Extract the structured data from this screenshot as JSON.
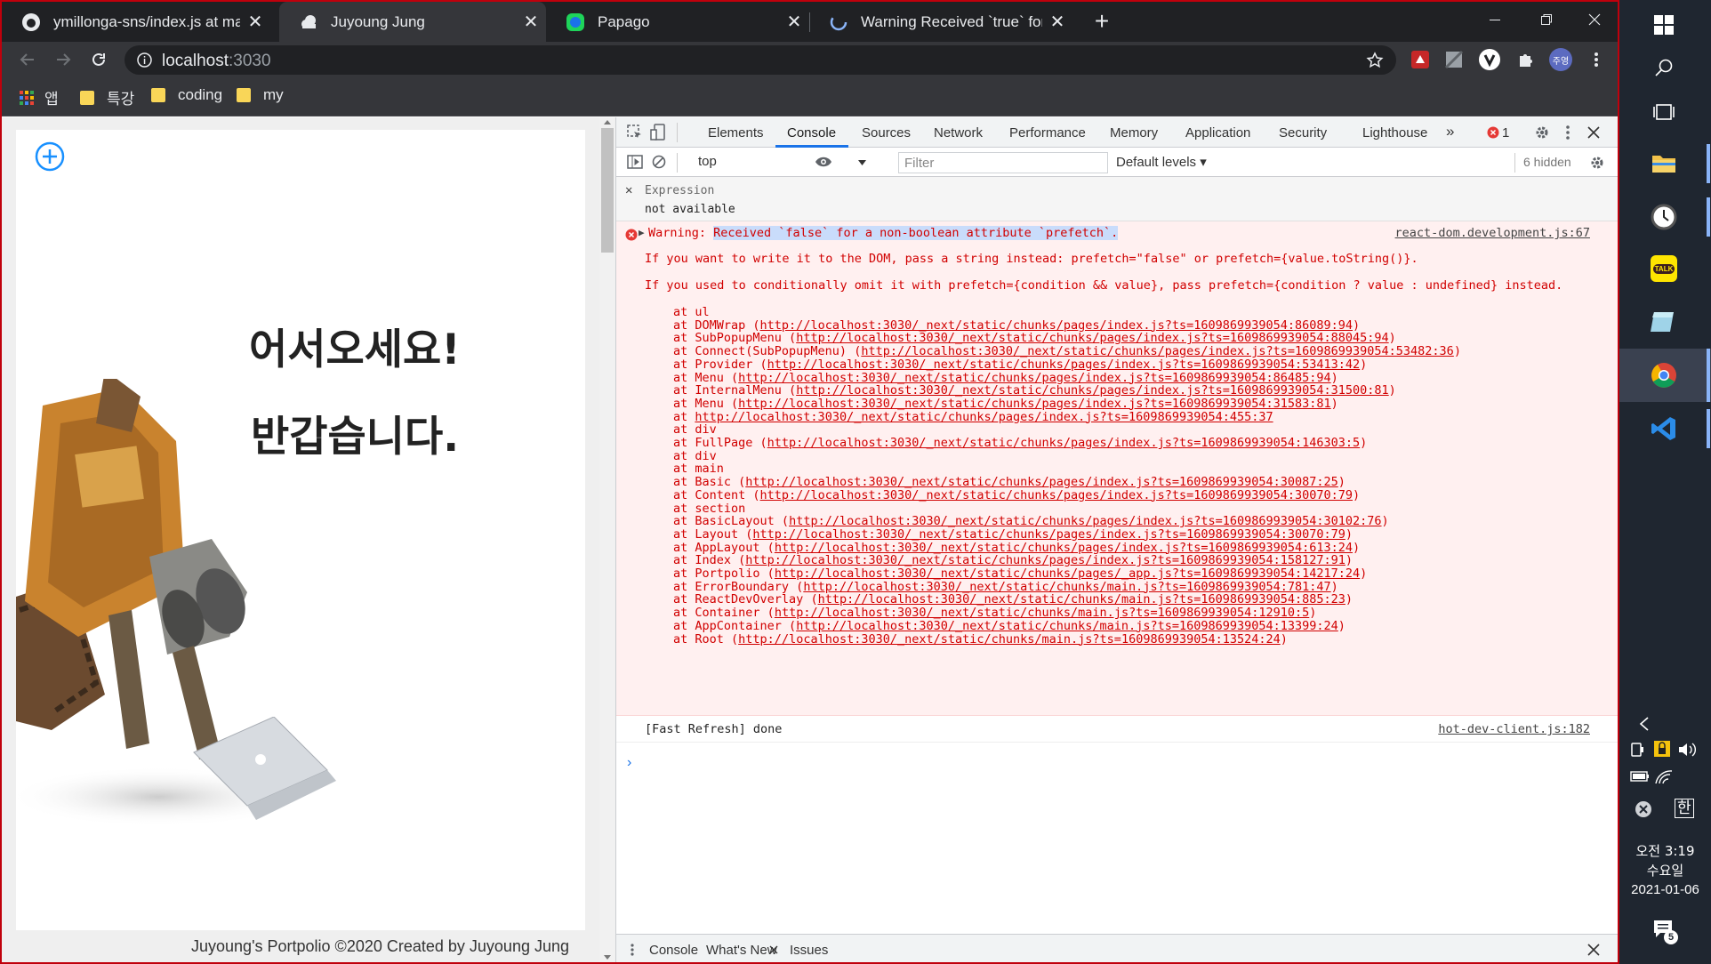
{
  "browser": {
    "tabs": [
      {
        "title": "ymillonga-sns/index.js at main ·",
        "icon": "github-icon"
      },
      {
        "title": "Juyoung Jung",
        "icon": "cloud-icon"
      },
      {
        "title": "Papago",
        "icon": "papago-icon"
      },
      {
        "title": "Warning Received `true` for non",
        "icon": "spinner-icon"
      }
    ],
    "url_host": "localhost",
    "url_port": ":3030",
    "bookmarks": [
      {
        "label": "앱"
      },
      {
        "label": "특강"
      },
      {
        "label": "coding"
      },
      {
        "label": "my"
      }
    ],
    "profile_badge": "주영"
  },
  "page": {
    "welcome_line1": "어서오세요!",
    "welcome_line2": "반갑습니다.",
    "footer": "Juyoung's Portpolio ©2020 Created by Juyoung Jung"
  },
  "devtools": {
    "tabs": [
      "Elements",
      "Console",
      "Sources",
      "Network",
      "Performance",
      "Memory",
      "Application",
      "Security",
      "Lighthouse"
    ],
    "error_count": "1",
    "context": "top",
    "filter_placeholder": "Filter",
    "levels": "Default levels",
    "hidden": "6 hidden",
    "expression_label": "Expression",
    "expression_value": "not available",
    "warning_prefix": "Warning: ",
    "warning_highlight": "Received `false` for a non-boolean attribute `prefetch`.",
    "warning_source": "react-dom.development.js:67",
    "warning_line2": "If you want to write it to the DOM, pass a string instead: prefetch=\"false\" or prefetch={value.toString()}.",
    "warning_line3": "If you used to conditionally omit it with prefetch={condition && value}, pass prefetch={condition ? value : undefined} instead.",
    "stack": [
      {
        "name": "ul",
        "url": ""
      },
      {
        "name": "DOMWrap",
        "url": "http://localhost:3030/_next/static/chunks/pages/index.js?ts=1609869939054:86089:94"
      },
      {
        "name": "SubPopupMenu",
        "url": "http://localhost:3030/_next/static/chunks/pages/index.js?ts=1609869939054:88045:94"
      },
      {
        "name": "Connect(SubPopupMenu)",
        "url": "http://localhost:3030/_next/static/chunks/pages/index.js?ts=1609869939054:53482:36"
      },
      {
        "name": "Provider",
        "url": "http://localhost:3030/_next/static/chunks/pages/index.js?ts=1609869939054:53413:42"
      },
      {
        "name": "Menu",
        "url": "http://localhost:3030/_next/static/chunks/pages/index.js?ts=1609869939054:86485:94"
      },
      {
        "name": "InternalMenu",
        "url": "http://localhost:3030/_next/static/chunks/pages/index.js?ts=1609869939054:31500:81"
      },
      {
        "name": "Menu",
        "url": "http://localhost:3030/_next/static/chunks/pages/index.js?ts=1609869939054:31583:81"
      },
      {
        "name": "",
        "url": "http://localhost:3030/_next/static/chunks/pages/index.js?ts=1609869939054:455:37"
      },
      {
        "name": "div",
        "url": ""
      },
      {
        "name": "FullPage",
        "url": "http://localhost:3030/_next/static/chunks/pages/index.js?ts=1609869939054:146303:5"
      },
      {
        "name": "div",
        "url": ""
      },
      {
        "name": "main",
        "url": ""
      },
      {
        "name": "Basic",
        "url": "http://localhost:3030/_next/static/chunks/pages/index.js?ts=1609869939054:30087:25"
      },
      {
        "name": "Content",
        "url": "http://localhost:3030/_next/static/chunks/pages/index.js?ts=1609869939054:30070:79"
      },
      {
        "name": "section",
        "url": ""
      },
      {
        "name": "BasicLayout",
        "url": "http://localhost:3030/_next/static/chunks/pages/index.js?ts=1609869939054:30102:76"
      },
      {
        "name": "Layout",
        "url": "http://localhost:3030/_next/static/chunks/pages/index.js?ts=1609869939054:30070:79"
      },
      {
        "name": "AppLayout",
        "url": "http://localhost:3030/_next/static/chunks/pages/index.js?ts=1609869939054:613:24"
      },
      {
        "name": "Index",
        "url": "http://localhost:3030/_next/static/chunks/pages/index.js?ts=1609869939054:158127:91"
      },
      {
        "name": "Portpolio",
        "url": "http://localhost:3030/_next/static/chunks/pages/_app.js?ts=1609869939054:14217:24"
      },
      {
        "name": "ErrorBoundary",
        "url": "http://localhost:3030/_next/static/chunks/main.js?ts=1609869939054:781:47"
      },
      {
        "name": "ReactDevOverlay",
        "url": "http://localhost:3030/_next/static/chunks/main.js?ts=1609869939054:885:23"
      },
      {
        "name": "Container",
        "url": "http://localhost:3030/_next/static/chunks/main.js?ts=1609869939054:12910:5"
      },
      {
        "name": "AppContainer",
        "url": "http://localhost:3030/_next/static/chunks/main.js?ts=1609869939054:13399:24"
      },
      {
        "name": "Root",
        "url": "http://localhost:3030/_next/static/chunks/main.js?ts=1609869939054:13524:24"
      }
    ],
    "fast_refresh": "[Fast Refresh] done",
    "fast_refresh_source": "hot-dev-client.js:182",
    "drawer_tabs": [
      "Console",
      "What's New",
      "Issues"
    ]
  },
  "taskbar": {
    "time_line1": "오전 3:19",
    "time_line2": "수요일",
    "date": "2021-01-06",
    "ime": "한",
    "notification_count": "5",
    "kakao_label": "TALK"
  },
  "colors": {
    "chrome_dark": "#202124",
    "chrome_toolbar": "#35363a",
    "devtools_accent": "#1a73e8",
    "error_red": "#d10000",
    "error_bg": "#fff0f0",
    "taskbar": "#1f2630",
    "frame_border": "#c0000c"
  }
}
